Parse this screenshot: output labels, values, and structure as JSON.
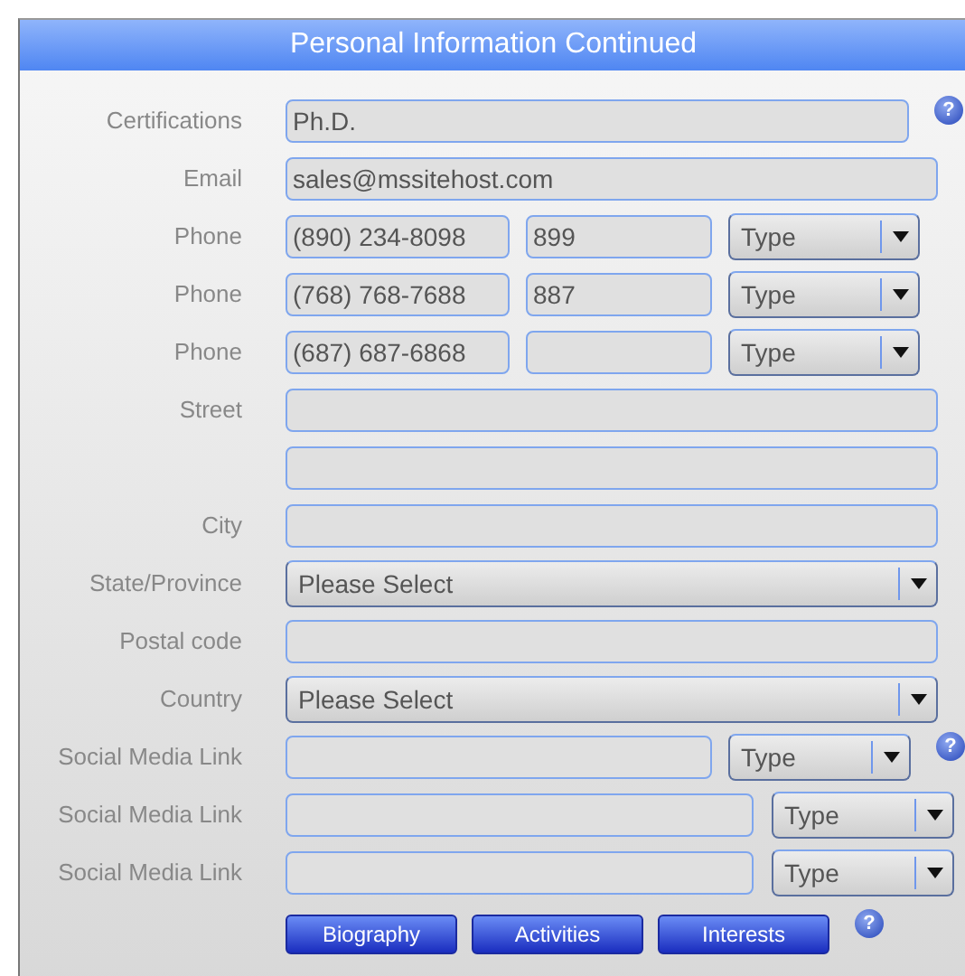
{
  "panel": {
    "title": "Personal Information Continued"
  },
  "rows": [
    {
      "label": "Certifications",
      "controls": [
        {
          "kind": "input",
          "value": "Ph.D."
        }
      ],
      "help": "?"
    },
    {
      "label": "Email",
      "controls": [
        {
          "kind": "input",
          "value": "sales@mssitehost.com"
        }
      ]
    },
    {
      "label": "Phone",
      "controls": [
        {
          "kind": "input",
          "value": "(890) 234-8098"
        },
        {
          "kind": "input",
          "value": "899"
        },
        {
          "kind": "select",
          "value": "Type"
        }
      ]
    },
    {
      "label": "Phone",
      "controls": [
        {
          "kind": "input",
          "value": "(768) 768-7688"
        },
        {
          "kind": "input",
          "value": "887"
        },
        {
          "kind": "select",
          "value": "Type"
        }
      ]
    },
    {
      "label": "Phone",
      "controls": [
        {
          "kind": "input",
          "value": "(687) 687-6868"
        },
        {
          "kind": "input"
        },
        {
          "kind": "select",
          "value": "Type"
        }
      ]
    },
    {
      "label": "Street",
      "controls": [
        {
          "kind": "input"
        }
      ]
    },
    {
      "controls": [
        {
          "kind": "input"
        }
      ]
    },
    {
      "label": "City",
      "controls": [
        {
          "kind": "input"
        }
      ]
    },
    {
      "label": "State/Province",
      "controls": [
        {
          "kind": "select",
          "value": "Please Select"
        }
      ]
    },
    {
      "label": "Postal code",
      "controls": [
        {
          "kind": "input"
        }
      ]
    },
    {
      "label": "Country",
      "controls": [
        {
          "kind": "select",
          "value": "Please Select"
        }
      ]
    },
    {
      "label": "Social Media Link",
      "controls": [
        {
          "kind": "input"
        },
        {
          "kind": "select",
          "value": "Type"
        }
      ],
      "help": "?"
    },
    {
      "label": "Social Media Link",
      "controls": [
        {
          "kind": "input"
        },
        {
          "kind": "select",
          "value": "Type"
        }
      ]
    },
    {
      "label": "Social Media Link",
      "controls": [
        {
          "kind": "input"
        },
        {
          "kind": "select",
          "value": "Type"
        }
      ]
    }
  ],
  "buttons": [
    "Biography",
    "Activities",
    "Interests"
  ],
  "buttons_help": "?"
}
